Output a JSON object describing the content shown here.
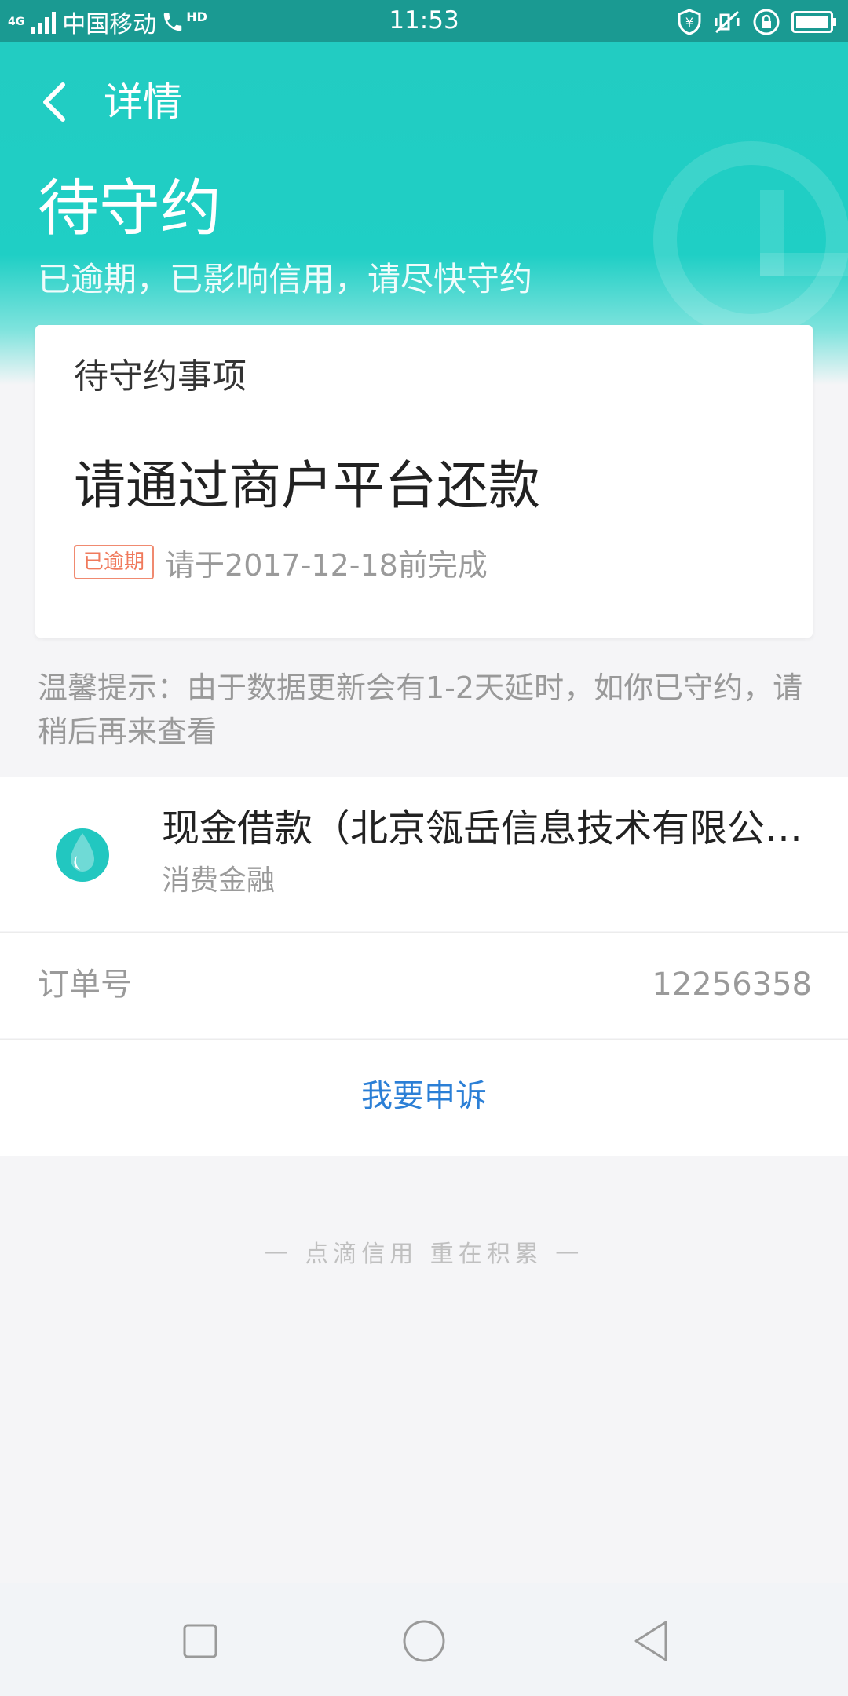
{
  "status_bar": {
    "network_small": "4G",
    "carrier": "中国移动",
    "hd": "HD",
    "time": "11:53"
  },
  "header": {
    "title": "详情",
    "status_title": "待守约",
    "status_desc": "已逾期，已影响信用，请尽快守约"
  },
  "card": {
    "header": "待守约事项",
    "main": "请通过商户平台还款",
    "badge": "已逾期",
    "deadline": "请于2017-12-18前完成"
  },
  "tip": "温馨提示：由于数据更新会有1-2天延时，如你已守约，请稍后再来查看",
  "merchant": {
    "name": "现金借款（北京瓴岳信息技术有限公司）",
    "category": "消费金融"
  },
  "order": {
    "label": "订单号",
    "value": "12256358"
  },
  "appeal": "我要申诉",
  "slogan": "一 点滴信用 重在积累 一",
  "colors": {
    "accent": "#1fcfc5",
    "status_bar": "#1a9a92",
    "link": "#2b7fd6",
    "overdue": "#f07a5c"
  },
  "icons": {
    "back": "chevron-left-icon",
    "shield": "shield-icon",
    "mute": "mute-icon",
    "lock": "rotation-lock-icon",
    "battery": "battery-icon",
    "merchant_logo": "water-drop-icon"
  }
}
